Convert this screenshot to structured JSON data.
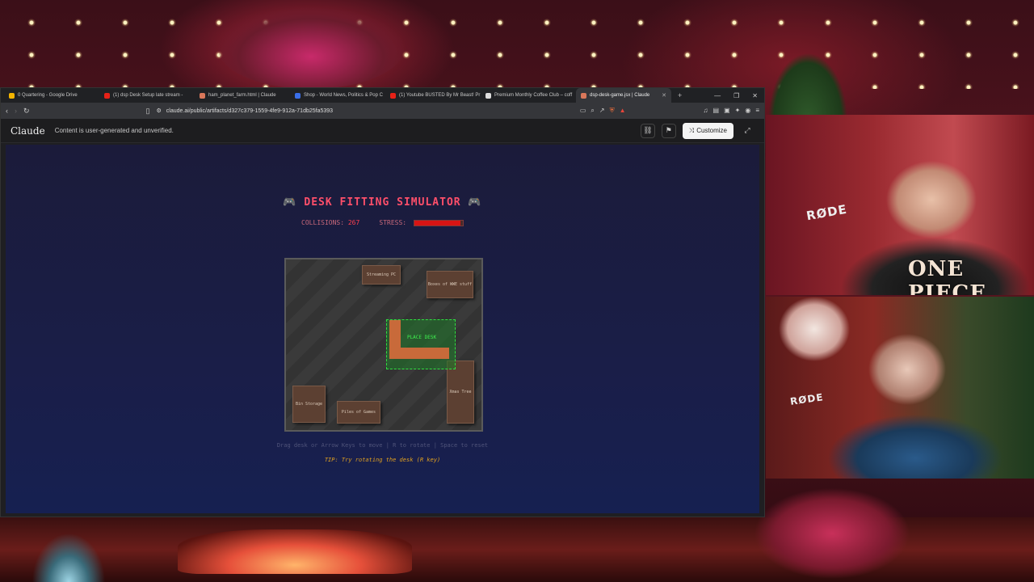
{
  "browser": {
    "tabs": [
      {
        "label": "0 Quartering - Google Drive",
        "color": "#f4b400",
        "active": false
      },
      {
        "label": "(1) dsp Desk Setup late stream -",
        "color": "#e62117",
        "active": false
      },
      {
        "label": "ham_planet_farm.html | Claude",
        "color": "#d9775a",
        "active": false
      },
      {
        "label": "Shop - World News, Politics & Pop C",
        "color": "#3a6ee8",
        "active": false
      },
      {
        "label": "(1) Youtube BUSTED By Mr Beast! Pr",
        "color": "#e62117",
        "active": false
      },
      {
        "label": "Premium Monthly Coffee Club – coff",
        "color": "#dddddd",
        "active": false
      },
      {
        "label": "dsp-desk-game.jsx | Claude",
        "color": "#d9775a",
        "active": true
      }
    ],
    "url": "claude.ai/public/artifacts/d327c379-1559-4fe9-912a-71db25fa5393"
  },
  "claude": {
    "logo": "Claude",
    "notice": "Content is user-generated and unverified.",
    "customize_label": "Customize"
  },
  "game": {
    "title": "DESK FITTING SIMULATOR",
    "collisions_label": "COLLISIONS:",
    "collisions_value": "267",
    "stress_label": "STRESS:",
    "stress_level": 0.95,
    "objects": {
      "streaming_pc": "Streaming PC",
      "boxes": "Boxes of WWE stuff",
      "xmas_tree": "Xmas Tree",
      "bin_storage": "Bin Storage",
      "piles_of_games": "Piles of Games"
    },
    "desk_label": "PLACE DESK",
    "instructions": "Drag desk or Arrow Keys to move | R to rotate | Space to reset",
    "tip": "TIP: Try rotating the desk (R key)"
  },
  "webcams": {
    "cam1_mic": "RØDE",
    "cam1_sweater": "ONE PIECE",
    "cam2_mic": "RØDE"
  },
  "colors": {
    "title": "#ff4f6a",
    "stress_fill": "#d81414",
    "desk": "#c86a3a",
    "desk_zone": "#2fe040",
    "tip": "#e0a020"
  }
}
